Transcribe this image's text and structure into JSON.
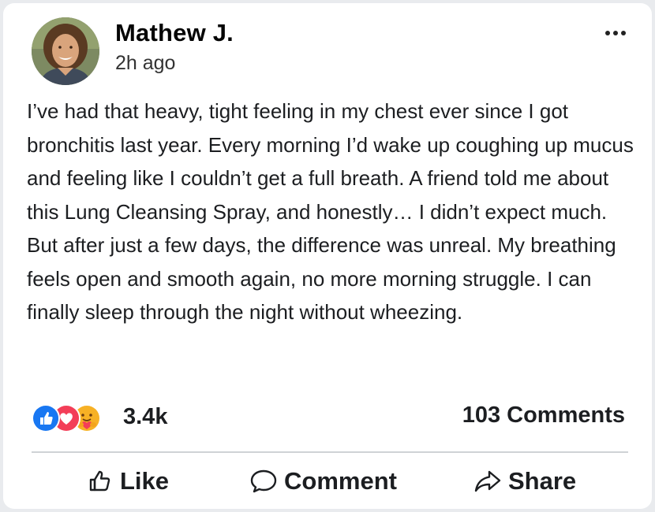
{
  "post": {
    "author": "Mathew J.",
    "timestamp": "2h ago",
    "text": "I’ve had that heavy, tight feeling in my chest ever since I got bronchitis last year. Every morning I’d wake up coughing up mucus and feeling like I couldn’t get a full breath. A friend told me about this Lung Cleansing Spray, and honestly… I didn’t expect much. But after just a few days, the difference was unreal. My breathing feels open and smooth again, no more morning struggle. I can finally sleep through the night without wheezing."
  },
  "reactions": {
    "icons": [
      "like-icon",
      "love-icon",
      "care-icon"
    ],
    "count": "3.4k"
  },
  "comments": {
    "count_label": "103 Comments"
  },
  "actions": {
    "like_label": "Like",
    "comment_label": "Comment",
    "share_label": "Share"
  },
  "colors": {
    "like_blue": "#1877f2",
    "love_red": "#f33e58",
    "care_yellow": "#f7b125",
    "divider": "#cfd2d6"
  }
}
